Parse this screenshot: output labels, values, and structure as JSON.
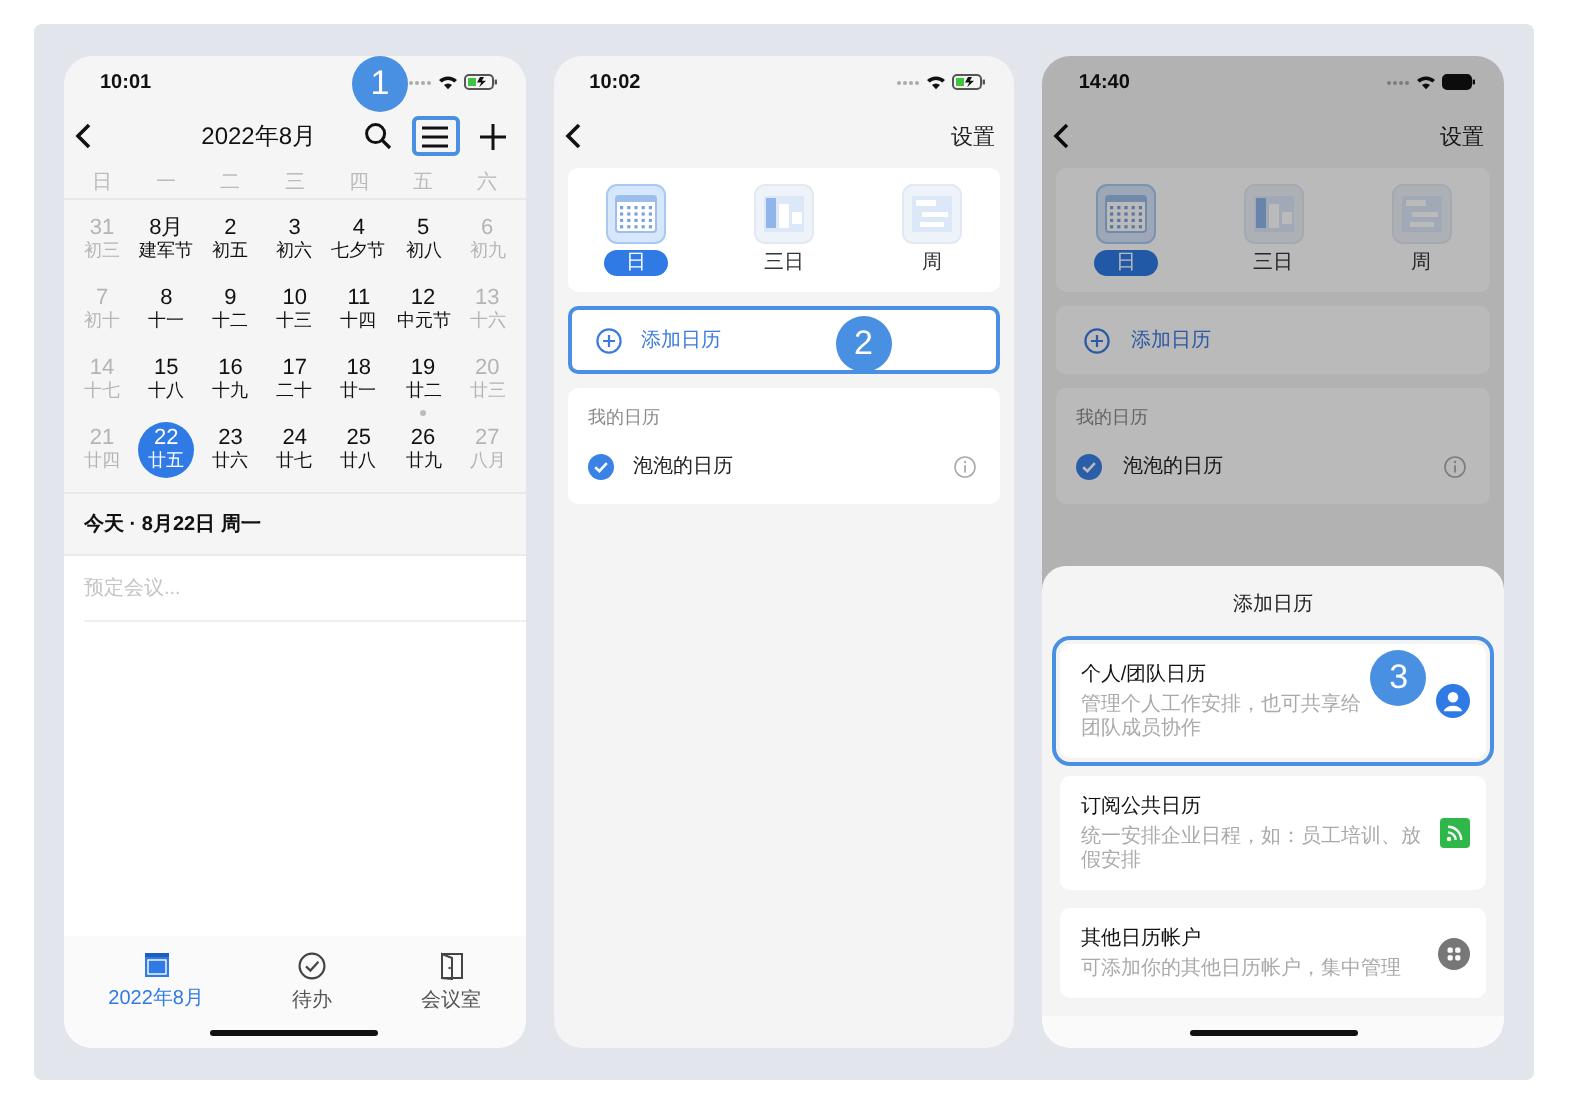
{
  "calendar_screen": {
    "status_time": "10:01",
    "battery_charging": true,
    "title": "2022年8月",
    "menu_highlighted": true,
    "step": "1",
    "weekdays": [
      "日",
      "一",
      "二",
      "三",
      "四",
      "五",
      "六"
    ],
    "weeks": [
      [
        {
          "day": "31",
          "lunar": "初三",
          "muted": true,
          "selected": false,
          "has_event": false
        },
        {
          "day": "8月",
          "lunar": "建军节",
          "muted": false,
          "selected": false,
          "has_event": false
        },
        {
          "day": "2",
          "lunar": "初五",
          "muted": false,
          "selected": false,
          "has_event": false
        },
        {
          "day": "3",
          "lunar": "初六",
          "muted": false,
          "selected": false,
          "has_event": false
        },
        {
          "day": "4",
          "lunar": "七夕节",
          "muted": false,
          "selected": false,
          "has_event": false
        },
        {
          "day": "5",
          "lunar": "初八",
          "muted": false,
          "selected": false,
          "has_event": false
        },
        {
          "day": "6",
          "lunar": "初九",
          "muted": true,
          "selected": false,
          "has_event": false
        }
      ],
      [
        {
          "day": "7",
          "lunar": "初十",
          "muted": true,
          "selected": false,
          "has_event": false
        },
        {
          "day": "8",
          "lunar": "十一",
          "muted": false,
          "selected": false,
          "has_event": false
        },
        {
          "day": "9",
          "lunar": "十二",
          "muted": false,
          "selected": false,
          "has_event": false
        },
        {
          "day": "10",
          "lunar": "十三",
          "muted": false,
          "selected": false,
          "has_event": false
        },
        {
          "day": "11",
          "lunar": "十四",
          "muted": false,
          "selected": false,
          "has_event": false
        },
        {
          "day": "12",
          "lunar": "中元节",
          "muted": false,
          "selected": false,
          "has_event": false
        },
        {
          "day": "13",
          "lunar": "十六",
          "muted": true,
          "selected": false,
          "has_event": false
        }
      ],
      [
        {
          "day": "14",
          "lunar": "十七",
          "muted": true,
          "selected": false,
          "has_event": false
        },
        {
          "day": "15",
          "lunar": "十八",
          "muted": false,
          "selected": false,
          "has_event": false
        },
        {
          "day": "16",
          "lunar": "十九",
          "muted": false,
          "selected": false,
          "has_event": false
        },
        {
          "day": "17",
          "lunar": "二十",
          "muted": false,
          "selected": false,
          "has_event": false
        },
        {
          "day": "18",
          "lunar": "廿一",
          "muted": false,
          "selected": false,
          "has_event": false
        },
        {
          "day": "19",
          "lunar": "廿二",
          "muted": false,
          "selected": false,
          "has_event": true
        },
        {
          "day": "20",
          "lunar": "廿三",
          "muted": true,
          "selected": false,
          "has_event": false
        }
      ],
      [
        {
          "day": "21",
          "lunar": "廿四",
          "muted": true,
          "selected": false,
          "has_event": false
        },
        {
          "day": "22",
          "lunar": "廿五",
          "muted": false,
          "selected": true,
          "has_event": false
        },
        {
          "day": "23",
          "lunar": "廿六",
          "muted": false,
          "selected": false,
          "has_event": false
        },
        {
          "day": "24",
          "lunar": "廿七",
          "muted": false,
          "selected": false,
          "has_event": false
        },
        {
          "day": "25",
          "lunar": "廿八",
          "muted": false,
          "selected": false,
          "has_event": false
        },
        {
          "day": "26",
          "lunar": "廿九",
          "muted": false,
          "selected": false,
          "has_event": false
        },
        {
          "day": "27",
          "lunar": "八月",
          "muted": true,
          "selected": false,
          "has_event": false
        }
      ]
    ],
    "today_heading": "今天 · 8月22日 周一",
    "event_placeholder": "预定会议...",
    "tabs": [
      {
        "label": "2022年8月",
        "kind": "calendar",
        "selected": true
      },
      {
        "label": "待办",
        "kind": "todo",
        "selected": false
      },
      {
        "label": "会议室",
        "kind": "room",
        "selected": false
      }
    ]
  },
  "settings_screen": {
    "status_time": "10:02",
    "battery_charging": true,
    "title": "设置",
    "step": "2",
    "add_highlighted": true,
    "views": [
      {
        "label": "日",
        "kind": "month",
        "selected": true
      },
      {
        "label": "三日",
        "kind": "three_day",
        "selected": false
      },
      {
        "label": "周",
        "kind": "week",
        "selected": false
      }
    ],
    "add_label": "添加日历",
    "section_label": "我的日历",
    "calendars": [
      {
        "name": "泡泡的日历",
        "checked": true
      }
    ]
  },
  "add_calendar_screen": {
    "status_time": "14:40",
    "battery_charging": false,
    "background": {
      "title": "设置",
      "add_highlighted": false,
      "views": [
        {
          "label": "日",
          "kind": "month",
          "selected": true
        },
        {
          "label": "三日",
          "kind": "three_day",
          "selected": false
        },
        {
          "label": "周",
          "kind": "week",
          "selected": false
        }
      ],
      "add_label": "添加日历",
      "section_label": "我的日历",
      "calendars": [
        {
          "name": "泡泡的日历",
          "checked": true
        }
      ]
    },
    "sheet": {
      "title": "添加日历",
      "step": "3",
      "options": [
        {
          "title": "个人/团队日历",
          "subtitle": "管理个人工作安排，也可共享给团队成员协作",
          "kind": "person",
          "highlighted": true
        },
        {
          "title": "订阅公共日历",
          "subtitle": "统一安排企业日程，如：员工培训、放假安排",
          "kind": "feed",
          "highlighted": false
        },
        {
          "title": "其他日历帐户",
          "subtitle": "可添加你的其他日历帐户，集中管理",
          "kind": "apps",
          "highlighted": false
        }
      ]
    }
  }
}
